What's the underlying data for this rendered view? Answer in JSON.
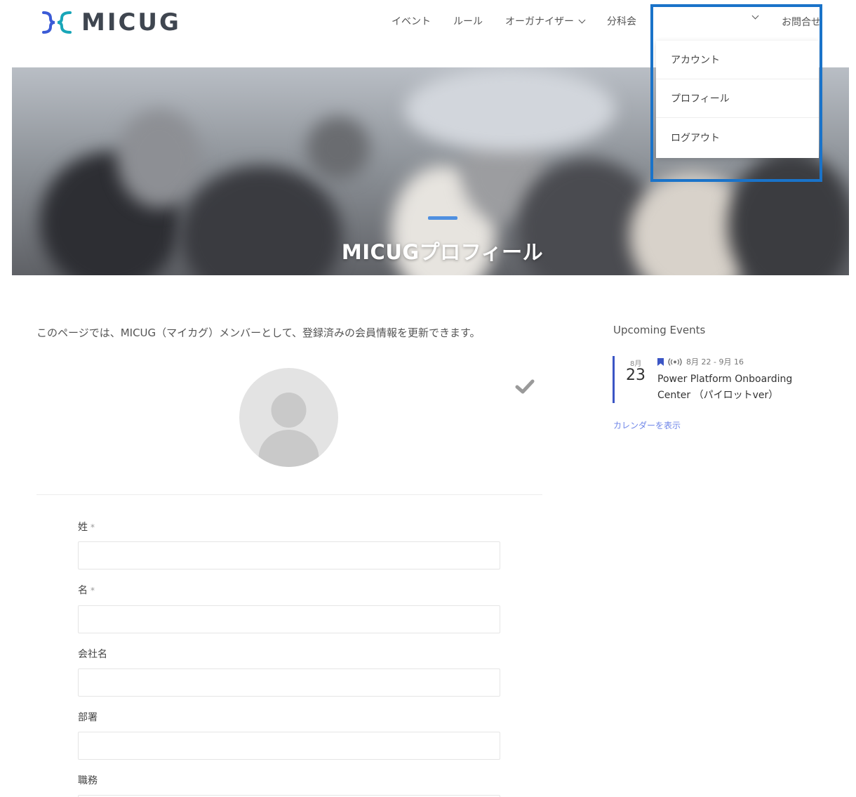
{
  "header": {
    "logo_text": "MICUG",
    "nav": [
      {
        "label": "イベント"
      },
      {
        "label": "ルール"
      },
      {
        "label": "オーガナイザー"
      },
      {
        "label": "分科会"
      }
    ],
    "contact_label": "お問合せ",
    "user_menu": [
      "アカウント",
      "プロフィール",
      "ログアウト"
    ]
  },
  "hero": {
    "title": "MICUGプロフィール"
  },
  "main": {
    "intro": "このページでは、MICUG（マイカグ）メンバーとして、登録済みの会員情報を更新できます。",
    "fields": [
      {
        "label": "姓",
        "required": true,
        "value": ""
      },
      {
        "label": "名",
        "required": true,
        "value": ""
      },
      {
        "label": "会社名",
        "required": false,
        "value": ""
      },
      {
        "label": "部署",
        "required": false,
        "value": ""
      },
      {
        "label": "職務",
        "required": false,
        "value": ""
      }
    ],
    "required_mark": "*"
  },
  "sidebar": {
    "title": "Upcoming Events",
    "event": {
      "month": "8月",
      "day": "23",
      "date_range": "8月 22 - 9月 16",
      "title": "Power Platform Onboarding Center （パイロットver）"
    },
    "calendar_link": "カレンダーを表示"
  },
  "colors": {
    "accent_blue": "#1a73c9",
    "event_bar": "#3b55c5",
    "link": "#6f86e8",
    "logo_teal": "#18a6b8",
    "logo_blue": "#3b5bd6"
  }
}
